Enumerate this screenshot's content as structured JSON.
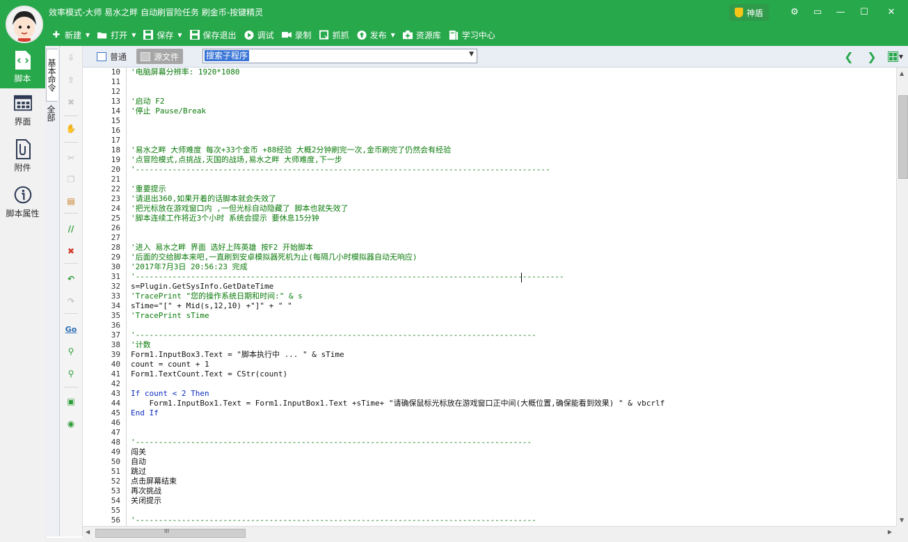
{
  "window": {
    "title": "效率模式-大师 易水之畔 自动刷冒险任务 刷金币-按键精灵",
    "shield_label": "神盾",
    "controls": {
      "settings": "⚙",
      "restore": "▭",
      "minimize": "—",
      "maximize": "☐",
      "close": "✕"
    },
    "accent_color": "#27a84b"
  },
  "menu": {
    "new": "新建",
    "open": "打开",
    "save": "保存",
    "save_exit": "保存退出",
    "debug": "调试",
    "record": "录制",
    "capture": "抓抓",
    "publish": "发布",
    "resources": "资源库",
    "learning": "学习中心"
  },
  "sidebar": {
    "items": [
      {
        "label": "脚本",
        "icon": "script-file-icon"
      },
      {
        "label": "界面",
        "icon": "form-grid-icon"
      },
      {
        "label": "附件",
        "icon": "attachment-icon"
      },
      {
        "label": "脚本属性",
        "icon": "info-icon"
      }
    ]
  },
  "vtabs": {
    "basic": "基本命令",
    "full": "全部"
  },
  "editor": {
    "mode_normal": "普通",
    "mode_source": "源文件",
    "combo_value": "搜索子程序",
    "combo_arrow": "▼",
    "prev_arrow": "❮",
    "next_arrow": "❯"
  },
  "line_numbers": [
    "10",
    "11",
    "12",
    "13",
    "14",
    "15",
    "16",
    "17",
    "18",
    "19",
    "20",
    "21",
    "22",
    "23",
    "24",
    "25",
    "26",
    "27",
    "28",
    "29",
    "30",
    "31",
    "32",
    "33",
    "34",
    "35",
    "36",
    "37",
    "38",
    "39",
    "40",
    "41",
    "42",
    "43",
    "44",
    "45",
    "46",
    "47",
    "48",
    "49",
    "50",
    "51",
    "52",
    "53",
    "54",
    "55",
    "56"
  ],
  "code_lines": [
    "'电脑屏幕分辨率: 1920*1080",
    "",
    "",
    "'启动 F2",
    "'停止 Pause/Break",
    "",
    "",
    "",
    "'易水之畔 大师难度 每次+33个金币 +88经验 大概2分钟刷完一次,金币刷完了仍然会有经验",
    "'点冒险模式,点挑战,灭国的战场,易水之畔 大师难度,下一步",
    "'------------------------------------------------------------------------------------------",
    "",
    "'重要提示",
    "'请退出360,如果开着的话脚本就会失效了",
    "'把光标放在游戏窗口内 ,一但光标自动隐藏了 脚本也就失效了",
    "'脚本连续工作将近3个小时 系统会提示 要休息15分钟",
    "",
    "",
    "'进入 易水之畔 界面 选好上阵英雄 按F2 开始脚本",
    "'后面的交给脚本来吧,一直刷到安卓模拟器死机为止(每隔几小时模拟器自动无响应)",
    "'2017年7月3日 20:56:23 完成",
    "'---------------------------------------------------------------------------------------------",
    "s=Plugin.GetSysInfo.GetDateTime",
    "'TracePrint \"您的操作系统日期和时间:\" & s",
    "sTime=\"[\" + Mid(s,12,10) +\"]\" + \" \"",
    "'TracePrint sTime",
    "",
    "'---------------------------------------------------------------------------------------",
    "'计数",
    "Form1.InputBox3.Text = \"脚本执行中 ... \" & sTime",
    "count = count + 1",
    "Form1.TextCount.Text = CStr(count)",
    "",
    "If count < 2 Then",
    "    Form1.InputBox1.Text = Form1.InputBox1.Text +sTime+ \"请确保鼠标光标放在游戏窗口正中间(大概位置,确保能看到效果) \" & vbcrlf",
    "End If",
    "",
    "",
    "'--------------------------------------------------------------------------------------",
    "闯关",
    "自动",
    "跳过",
    "点击屏幕结束",
    "再次挑战",
    "关闭提示",
    "",
    "'---------------------------------------------------------------------------------------"
  ],
  "line_styles": [
    "cm",
    "",
    "",
    "cm",
    "cm",
    "",
    "",
    "",
    "cm",
    "cm",
    "cm",
    "",
    "cm",
    "cm",
    "cm",
    "cm",
    "",
    "",
    "cm",
    "cm",
    "cm",
    "cm",
    "",
    "cm",
    "",
    "cm",
    "",
    "cm",
    "cm",
    "",
    "",
    "",
    "",
    "kw",
    "",
    "kw",
    "",
    "",
    "cm",
    "",
    "",
    "",
    "",
    "",
    "",
    "",
    "cm"
  ],
  "scroll": {
    "up": "▲",
    "down": "▼",
    "left": "◀",
    "right": "▶",
    "grip": "III"
  }
}
